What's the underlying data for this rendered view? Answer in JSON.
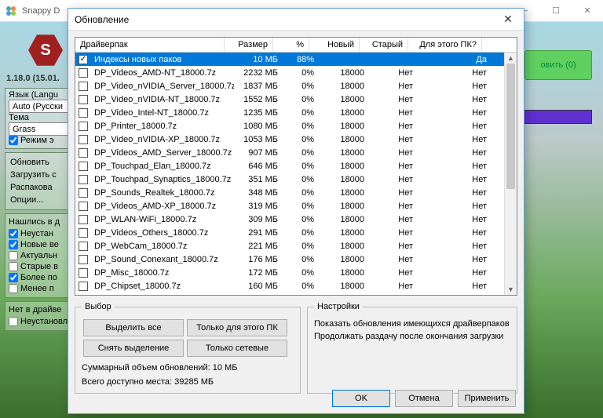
{
  "parent": {
    "title": "Snappy D",
    "green_button": "овить (0)",
    "version": "1.18.0 (15.01."
  },
  "lang_group": {
    "label": "Язык (Langu",
    "value": "Auto (Русски"
  },
  "theme_group": {
    "label": "Тема",
    "value": "Grass",
    "expert": "Режим э"
  },
  "actions": {
    "a1": "Обновить",
    "a2": "Загрузить с",
    "a3": "Распакова",
    "a4": "Опции..."
  },
  "found": {
    "title": "Нашлись в д",
    "items": [
      {
        "label": "Неустан",
        "checked": true
      },
      {
        "label": "Новые ве",
        "checked": true
      },
      {
        "label": "Актуальн",
        "checked": false
      },
      {
        "label": "Старые в",
        "checked": false
      },
      {
        "label": "Более по",
        "checked": true
      },
      {
        "label": "Менее п",
        "checked": false
      }
    ]
  },
  "missing": {
    "title": "Нет в драйве",
    "item": "Неустановленные"
  },
  "dialog": {
    "title": "Обновление",
    "columns": {
      "name": "Драйверпак",
      "size": "Размер",
      "pct": "%",
      "new": "Новый",
      "old": "Старый",
      "pc": "Для этого ПК?"
    },
    "rows": [
      {
        "checked": true,
        "name": "Индексы новых паков",
        "size": "10 МБ",
        "pct": "88%",
        "new": "",
        "old": "",
        "pc": "Да",
        "sel": true
      },
      {
        "checked": false,
        "name": "DP_Videos_AMD-NT_18000.7z",
        "size": "2232 МБ",
        "pct": "0%",
        "new": "18000",
        "old": "Нет",
        "pc": "Нет"
      },
      {
        "checked": false,
        "name": "DP_Video_nVIDIA_Server_18000.7z",
        "size": "1837 МБ",
        "pct": "0%",
        "new": "18000",
        "old": "Нет",
        "pc": "Нет"
      },
      {
        "checked": false,
        "name": "DP_Video_nVIDIA-NT_18000.7z",
        "size": "1552 МБ",
        "pct": "0%",
        "new": "18000",
        "old": "Нет",
        "pc": "Нет"
      },
      {
        "checked": false,
        "name": "DP_Video_Intel-NT_18000.7z",
        "size": "1235 МБ",
        "pct": "0%",
        "new": "18000",
        "old": "Нет",
        "pc": "Нет"
      },
      {
        "checked": false,
        "name": "DP_Printer_18000.7z",
        "size": "1080 МБ",
        "pct": "0%",
        "new": "18000",
        "old": "Нет",
        "pc": "Нет"
      },
      {
        "checked": false,
        "name": "DP_Video_nVIDIA-XP_18000.7z",
        "size": "1053 МБ",
        "pct": "0%",
        "new": "18000",
        "old": "Нет",
        "pc": "Нет"
      },
      {
        "checked": false,
        "name": "DP_Videos_AMD_Server_18000.7z",
        "size": "907 МБ",
        "pct": "0%",
        "new": "18000",
        "old": "Нет",
        "pc": "Нет"
      },
      {
        "checked": false,
        "name": "DP_Touchpad_Elan_18000.7z",
        "size": "646 МБ",
        "pct": "0%",
        "new": "18000",
        "old": "Нет",
        "pc": "Нет"
      },
      {
        "checked": false,
        "name": "DP_Touchpad_Synaptics_18000.7z",
        "size": "351 МБ",
        "pct": "0%",
        "new": "18000",
        "old": "Нет",
        "pc": "Нет"
      },
      {
        "checked": false,
        "name": "DP_Sounds_Realtek_18000.7z",
        "size": "348 МБ",
        "pct": "0%",
        "new": "18000",
        "old": "Нет",
        "pc": "Нет"
      },
      {
        "checked": false,
        "name": "DP_Videos_AMD-XP_18000.7z",
        "size": "319 МБ",
        "pct": "0%",
        "new": "18000",
        "old": "Нет",
        "pc": "Нет"
      },
      {
        "checked": false,
        "name": "DP_WLAN-WiFi_18000.7z",
        "size": "309 МБ",
        "pct": "0%",
        "new": "18000",
        "old": "Нет",
        "pc": "Нет"
      },
      {
        "checked": false,
        "name": "DP_Videos_Others_18000.7z",
        "size": "291 МБ",
        "pct": "0%",
        "new": "18000",
        "old": "Нет",
        "pc": "Нет"
      },
      {
        "checked": false,
        "name": "DP_WebCam_18000.7z",
        "size": "221 МБ",
        "pct": "0%",
        "new": "18000",
        "old": "Нет",
        "pc": "Нет"
      },
      {
        "checked": false,
        "name": "DP_Sound_Conexant_18000.7z",
        "size": "176 МБ",
        "pct": "0%",
        "new": "18000",
        "old": "Нет",
        "pc": "Нет"
      },
      {
        "checked": false,
        "name": "DP_Misc_18000.7z",
        "size": "172 МБ",
        "pct": "0%",
        "new": "18000",
        "old": "Нет",
        "pc": "Нет"
      },
      {
        "checked": false,
        "name": "DP_Chipset_18000.7z",
        "size": "160 МБ",
        "pct": "0%",
        "new": "18000",
        "old": "Нет",
        "pc": "Нет"
      }
    ],
    "selection": {
      "legend": "Выбор",
      "select_all": "Выделить все",
      "only_this_pc": "Только для этого ПК",
      "clear": "Снять выделение",
      "only_net": "Только сетевые",
      "summary": "Суммарный объем обновлений: 10 МБ",
      "freespace": "Всего доступно места: 39285 МБ"
    },
    "settings": {
      "legend": "Настройки",
      "l1": "Показать обновления имеющихся драйверпаков",
      "l2": "Продолжать раздачу после окончания загрузки"
    },
    "buttons": {
      "ok": "OK",
      "cancel": "Отмена",
      "apply": "Применить"
    }
  }
}
